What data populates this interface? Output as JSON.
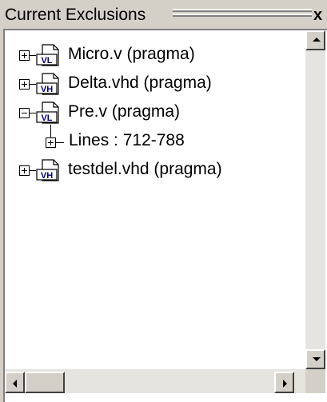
{
  "panel": {
    "title": "Current Exclusions",
    "close_label": "x"
  },
  "tree": {
    "items": [
      {
        "label": "Micro.v  (pragma)",
        "icon": "verilog-file-icon",
        "icon_text": "VL",
        "expanded": false
      },
      {
        "label": "Delta.vhd  (pragma)",
        "icon": "vhdl-file-icon",
        "icon_text": "VH",
        "expanded": false
      },
      {
        "label": "Pre.v  (pragma)",
        "icon": "verilog-file-icon",
        "icon_text": "VL",
        "expanded": true,
        "children": [
          {
            "label": "Lines : 712-788",
            "expanded": false
          }
        ]
      },
      {
        "label": "testdel.vhd  (pragma)",
        "icon": "vhdl-file-icon",
        "icon_text": "VH",
        "expanded": false
      }
    ]
  },
  "scrollbars": {
    "vertical": {
      "up_icon": "arrow-up-icon",
      "down_icon": "arrow-down-icon"
    },
    "horizontal": {
      "left_icon": "arrow-left-icon",
      "right_icon": "arrow-right-icon"
    }
  }
}
